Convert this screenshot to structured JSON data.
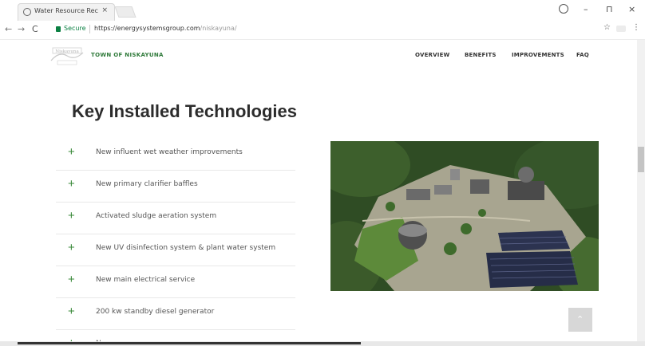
{
  "browser": {
    "tab_title": "Water Resource Recove...",
    "tab_close": "×",
    "secure_label": "Secure",
    "url_host": "https://energysystemsgroup.com",
    "url_path": "/niskayuna/",
    "back": "←",
    "forward": "→",
    "reload": "C",
    "star": "☆",
    "menu": "⋮",
    "minimize": "–",
    "maximize": "⊓",
    "close": "×"
  },
  "site": {
    "brand": "TOWN OF NISKAYUNA",
    "logo_text": "Niskayuna",
    "menu": [
      "OVERVIEW",
      "BENEFITS",
      "IMPROVEMENTS",
      "FAQ"
    ]
  },
  "main": {
    "title": "Key Installed Technologies",
    "plus": "+",
    "items": [
      "New influent wet weather improvements",
      "New primary clarifier baffles",
      "Activated sludge aeration system",
      "New UV disinfection system & plant water system",
      "New main electrical service",
      "200 kw standby diesel generator",
      "New"
    ]
  },
  "to_top": "⌃",
  "colors": {
    "brand_green": "#2f7a3a",
    "plus_green": "#3a8a3a",
    "secure_green": "#0b8043"
  }
}
